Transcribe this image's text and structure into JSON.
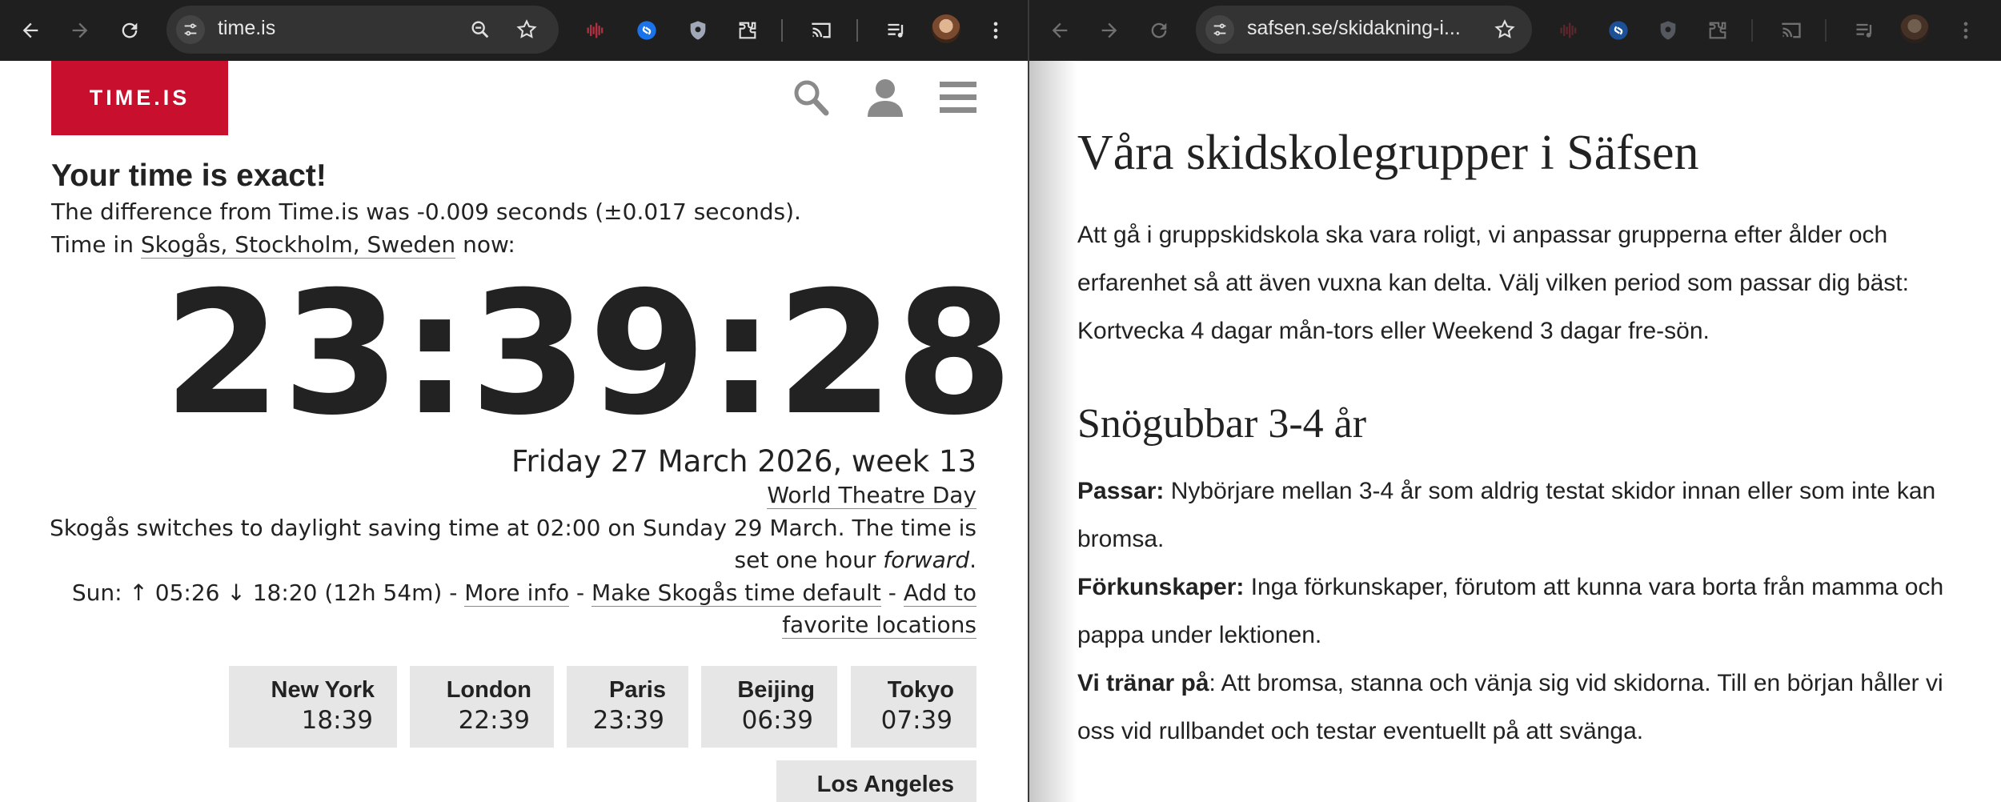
{
  "left_window": {
    "toolbar": {
      "url": "time.is"
    },
    "page": {
      "logo": "TIME.IS",
      "heading": "Your time is exact!",
      "difference_text": "The difference from Time.is was -0.009 seconds (±0.017 seconds).",
      "time_in_prefix": "Time in ",
      "location_link": "Skogås, Stockholm, Sweden",
      "time_in_suffix": " now:",
      "clock": "23:39:28",
      "date": "Friday 27 March 2026, week 13",
      "observance_link": "World Theatre Day",
      "dst_line1": "Skogås switches to daylight saving time at 02:00 on Sunday 29 March. The time is",
      "dst_line2_prefix": "set one hour ",
      "dst_line2_em": "forward",
      "dst_line2_suffix": ".",
      "sun_text": "Sun: ↑ 05:26 ↓ 18:20 (12h 54m) - ",
      "more_info_link": "More info",
      "sep1": " - ",
      "default_link": "Make Skogås time default",
      "sep2": " - ",
      "add_link_part1": "Add to",
      "add_link_part2": "favorite locations",
      "cities": [
        {
          "name": "New York",
          "time": "18:39"
        },
        {
          "name": "London",
          "time": "22:39"
        },
        {
          "name": "Paris",
          "time": "23:39"
        },
        {
          "name": "Beijing",
          "time": "06:39"
        },
        {
          "name": "Tokyo",
          "time": "07:39"
        },
        {
          "name": "Los Angeles",
          "time": ""
        }
      ]
    }
  },
  "right_window": {
    "toolbar": {
      "url": "safsen.se/skidakning-i..."
    },
    "page": {
      "title": "Våra skidskolegrupper i Säfsen",
      "intro": "Att gå i gruppskidskola ska vara roligt, vi anpassar grupperna efter ålder och erfarenhet så att även vuxna kan delta. Välj vilken period som passar dig bäst: Kortvecka 4 dagar mån-tors eller Weekend 3 dagar fre-sön.",
      "group_title": "Snögubbar 3-4 år",
      "passar_label": "Passar:",
      "passar_text": " Nybörjare mellan 3-4 år som aldrig testat skidor innan eller som inte kan bromsa.",
      "forkunskaper_label": "Förkunskaper:",
      "forkunskaper_text": " Inga förkunskaper, förutom att kunna vara borta från mamma och pappa under lektionen.",
      "tranar_label": "Vi tränar på",
      "tranar_text": ": Att bromsa, stanna och vänja sig vid skidorna. Till en början håller vi oss vid rullbandet och testar eventuellt på att svänga."
    }
  },
  "colors": {
    "toolbar_bg": "#1f1f1f",
    "omnibox_bg": "#333333",
    "timeis_red": "#c8102e",
    "city_box_bg": "#e6e6e6",
    "text": "#222222",
    "shazam_blue": "#1a73e8"
  },
  "icons": [
    "back-icon",
    "forward-icon",
    "reload-icon",
    "site-info-icon",
    "zoom-icon",
    "bookmark-star-icon",
    "waveform-extension-icon",
    "shazam-extension-icon",
    "shield-extension-icon",
    "puzzle-extensions-icon",
    "cast-icon",
    "media-queue-icon",
    "profile-avatar",
    "kebab-menu-icon",
    "search-icon",
    "user-icon",
    "hamburger-menu-icon"
  ]
}
